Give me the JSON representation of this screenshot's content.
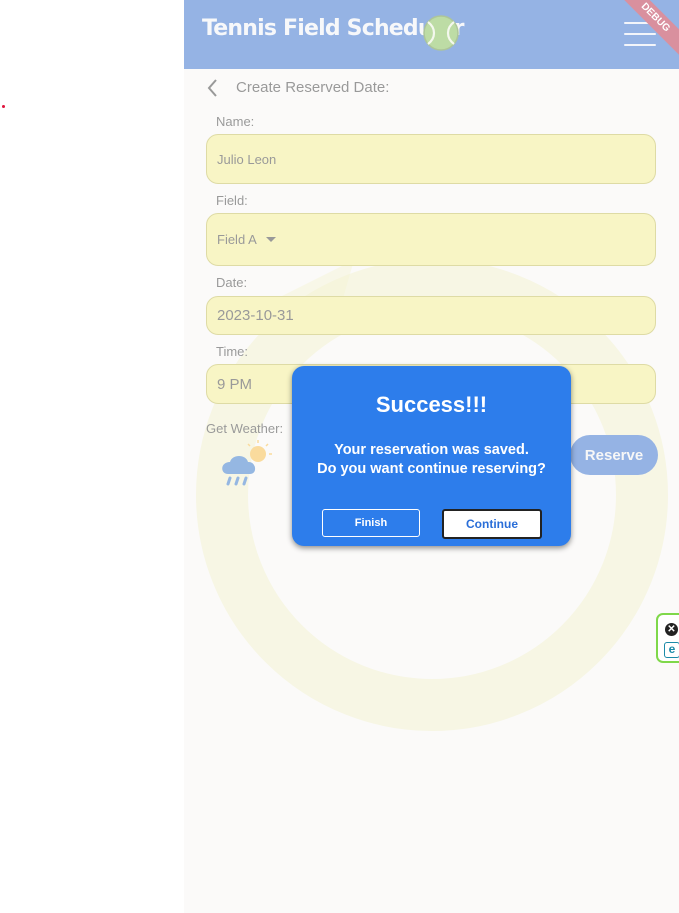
{
  "app": {
    "title": "Tennis Field Scheduler",
    "debug_banner": "DEBUG",
    "colors": {
      "appbar": "#2a66c9",
      "field_fill": "#f0ea8a",
      "dialog": "#2d7deb"
    },
    "icons": {
      "logo": "tennis-ball-icon",
      "menu": "hamburger-menu-icon",
      "back": "chevron-left-icon",
      "weather": "rain-cloud-sun-icon"
    }
  },
  "form": {
    "heading": "Create Reserved Date:",
    "name_label": "Name:",
    "name_value": "Julio Leon",
    "field_label": "Field:",
    "field_value": "Field A",
    "date_label": "Date:",
    "date_value": "2023-10-31",
    "time_label": "Time:",
    "time_value": "9 PM",
    "weather_label": "Get Weather:",
    "reserve_label": "Reserve"
  },
  "dialog": {
    "title": "Success!!!",
    "message_line1": "Your reservation was saved.",
    "message_line2": "Do you want continue reserving?",
    "finish_label": "Finish",
    "continue_label": "Continue"
  },
  "extension": {
    "close_glyph": "✕",
    "logo_glyph": "e"
  }
}
